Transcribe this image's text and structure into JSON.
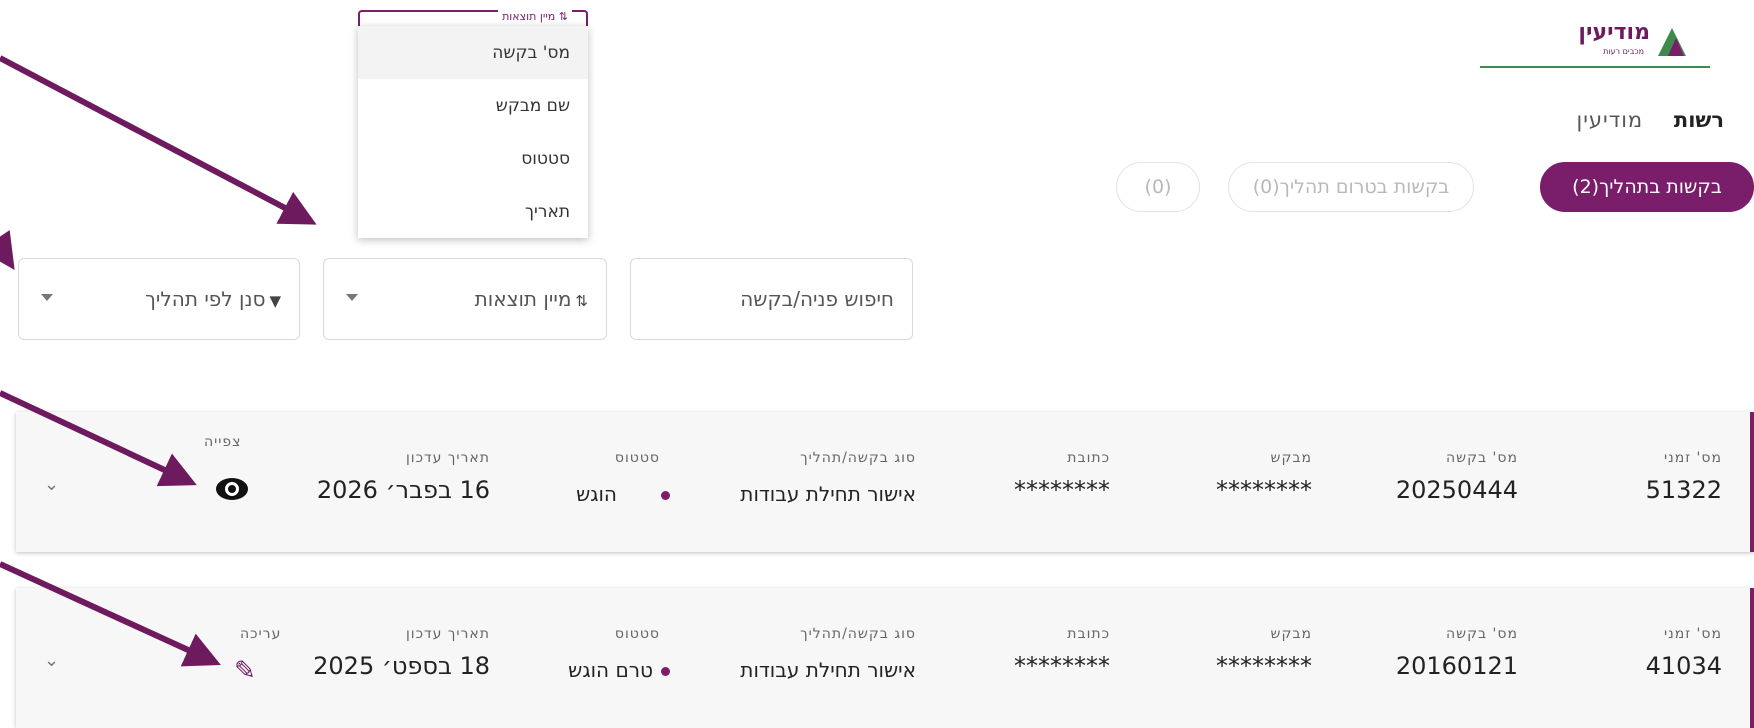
{
  "logo": {
    "text": "מודיעין",
    "sub": "מכבים רעות"
  },
  "authority": {
    "label": "רשות",
    "value": "מודיעין"
  },
  "tabs": [
    {
      "label": "בקשות בתהליך(2)",
      "active": true
    },
    {
      "label": "בקשות בטרום תהליך(0)",
      "active": false
    },
    {
      "label": "(0)",
      "active": false
    }
  ],
  "filters": {
    "search_placeholder": "חיפוש פניה/בקשה",
    "sort_label": "מיין תוצאות",
    "process_filter_label": "סנן לפי תהליך"
  },
  "sort_dropdown": {
    "label": "מיין תוצאות",
    "options": [
      "מס' בקשה",
      "שם מבקש",
      "סטטוס",
      "תאריך"
    ],
    "highlighted": "מס' בקשה"
  },
  "columns": {
    "temp_no": "מס' זמני",
    "request_no": "מס' בקשה",
    "applicant": "מבקש",
    "address": "כתובת",
    "type": "סוג בקשה/תהליך",
    "status": "סטטוס",
    "updated": "תאריך עדכון"
  },
  "requests": [
    {
      "temp_no": "51322",
      "request_no": "20250444",
      "applicant": "********",
      "address": "********",
      "type": "אישור תחילת עבודות",
      "status": "הוגש",
      "updated": "16 בפבר׳ 2026",
      "action_label": "צפייה",
      "action_icon": "eye-icon"
    },
    {
      "temp_no": "41034",
      "request_no": "20160121",
      "applicant": "********",
      "address": "********",
      "type": "אישור תחילת עבודות",
      "status": "טרם הוגש",
      "updated": "18 בספט׳ 2025",
      "action_label": "עריכה",
      "action_icon": "pencil-icon"
    }
  ],
  "colors": {
    "brand": "#7a1d6b",
    "arrow": "#6e1a5e",
    "logo_green": "#3e8a4a"
  }
}
